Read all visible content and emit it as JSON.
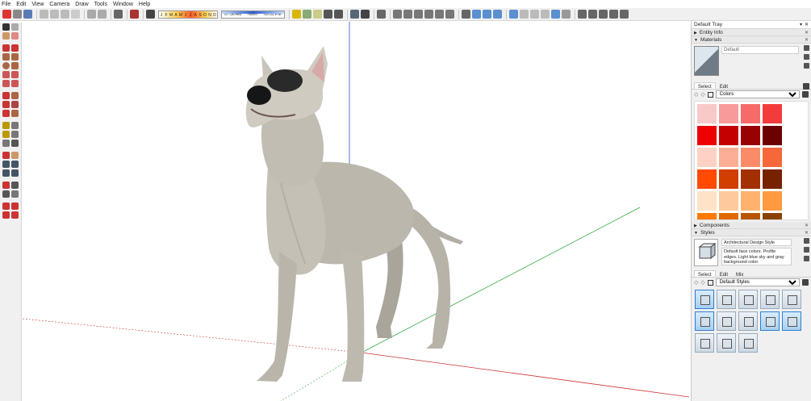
{
  "menu": [
    "File",
    "Edit",
    "View",
    "Camera",
    "Draw",
    "Tools",
    "Window",
    "Help"
  ],
  "shadows": {
    "months": [
      "J",
      "F",
      "M",
      "A",
      "M",
      "J",
      "J",
      "A",
      "S",
      "O",
      "N",
      "D"
    ],
    "time_labels": [
      "07:36 AM",
      "Noon",
      "05:33 PM"
    ]
  },
  "tray": {
    "title": "Default Tray",
    "entity_info": "Entity Info",
    "materials": {
      "header": "Materials",
      "name": "Default",
      "tabs": [
        "Select",
        "Edit"
      ],
      "library": "Colors",
      "colors": [
        "#f9c9c9",
        "#f99a9a",
        "#f76a6a",
        "#f43b3b",
        "#ee0000",
        "#c40000",
        "#990000",
        "#6a0000",
        "#fdd2c4",
        "#fcae96",
        "#f98b68",
        "#f6673a",
        "#ff4a00",
        "#d23d00",
        "#a42f00",
        "#762200",
        "#ffe2c8",
        "#ffca9b",
        "#ffb26e",
        "#ff9a41",
        "#ff7a00",
        "#e06a00",
        "#b85600",
        "#8a4100"
      ]
    },
    "components": "Components",
    "styles": {
      "header": "Styles",
      "name": "Architectural Design Style",
      "description": "Default face colors. Profile edges. Light blue sky and gray background color.",
      "tabs": [
        "Select",
        "Edit",
        "Mix"
      ],
      "library": "Default Styles",
      "items": 13
    }
  },
  "colors": {
    "accent": "#2a7fd4",
    "axis_red": "#cc3333",
    "axis_green": "#33aa44",
    "axis_blue": "#3344cc",
    "dog": "#b9b6ac"
  }
}
